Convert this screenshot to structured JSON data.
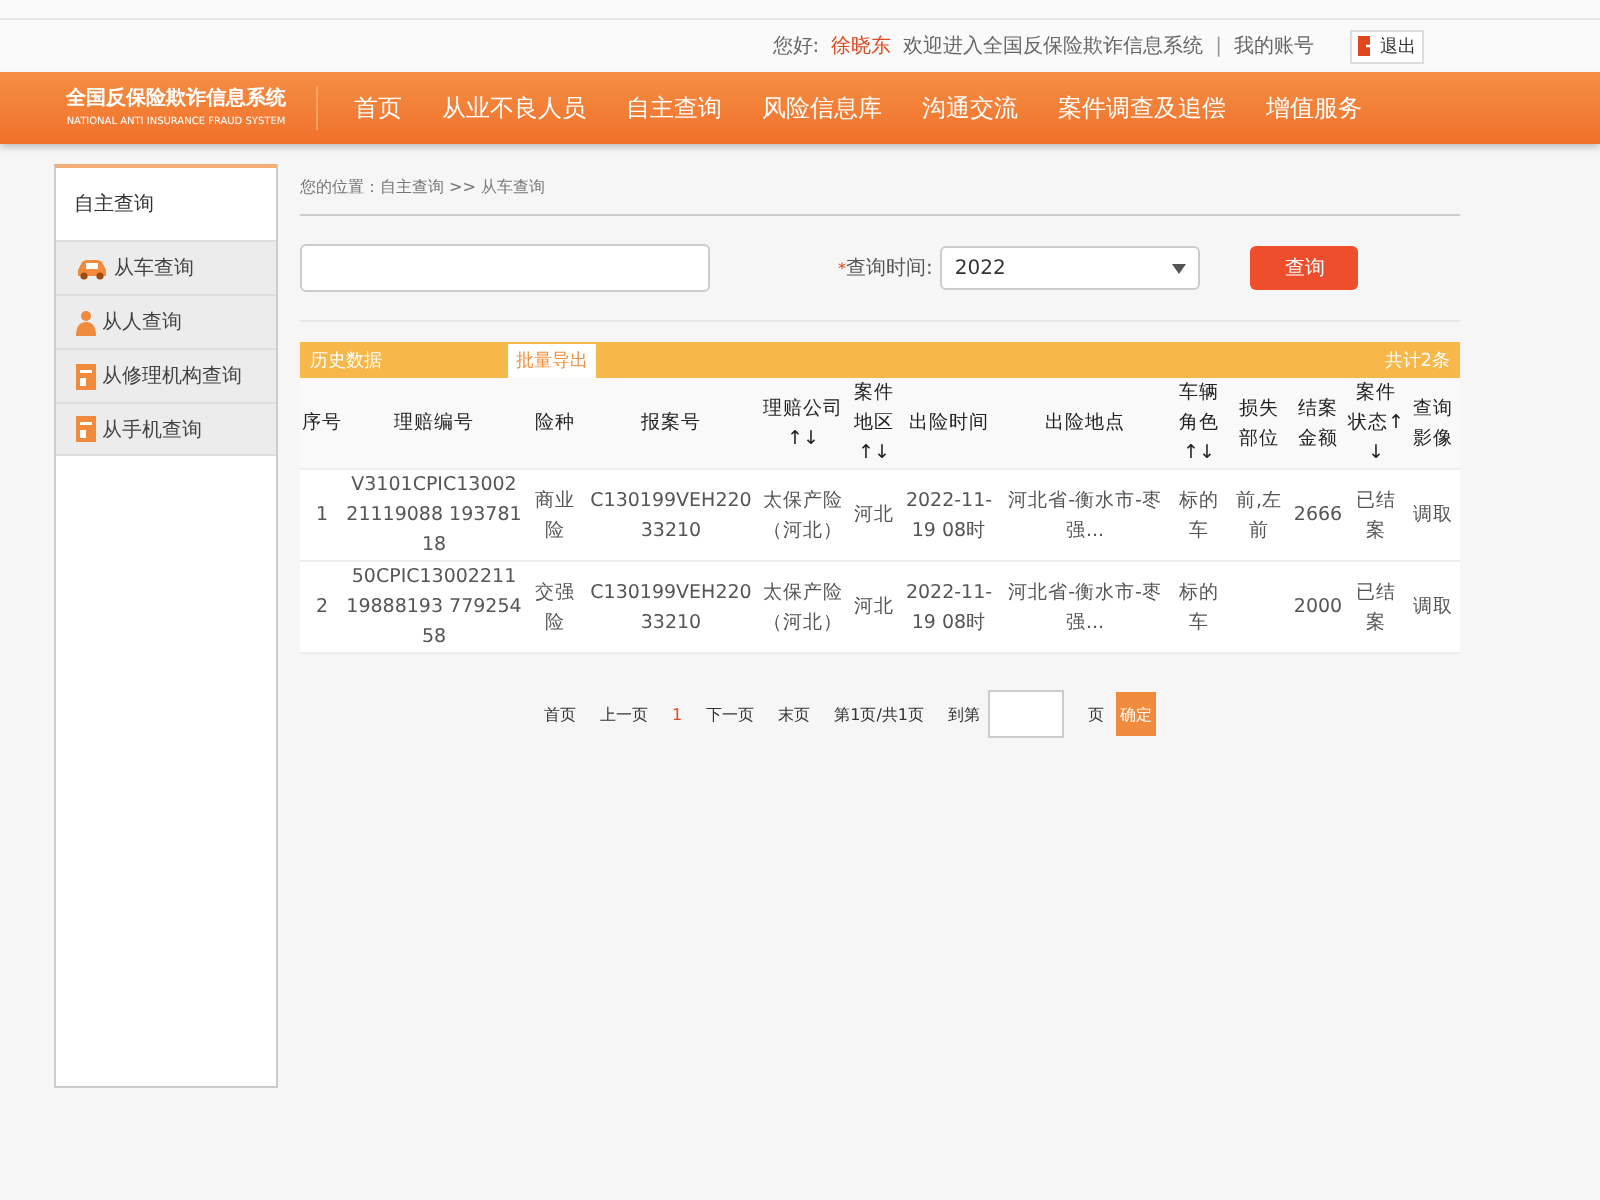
{
  "header": {
    "greeting": "您好:",
    "user": "徐晓东",
    "welcome": "欢迎进入全国反保险欺诈信息系统",
    "separator": "|",
    "account": "我的账号",
    "logout": "退出"
  },
  "logo": {
    "title": "全国反保险欺诈信息系统",
    "subtitle": "NATIONAL ANTI INSURANCE FRAUD SYSTEM"
  },
  "nav": [
    {
      "label": "首页"
    },
    {
      "label": "从业不良人员"
    },
    {
      "label": "自主查询"
    },
    {
      "label": "风险信息库"
    },
    {
      "label": "沟通交流"
    },
    {
      "label": "案件调查及追偿"
    },
    {
      "label": "增值服务"
    }
  ],
  "sidebar": {
    "title": "自主查询",
    "items": [
      {
        "label": "从车查询",
        "kind": "car"
      },
      {
        "label": "从人查询",
        "kind": "person"
      },
      {
        "label": "从修理机构查询",
        "kind": "document"
      },
      {
        "label": "从手机查询",
        "kind": "document"
      }
    ]
  },
  "breadcrumb": "您的位置：自主查询 >> 从车查询",
  "search": {
    "required_mark": "*",
    "time_label": "查询时间:",
    "year": "2022",
    "button": "查询"
  },
  "results": {
    "title": "历史数据",
    "export": "批量导出",
    "total": "共计2条",
    "columns": [
      "序号",
      "理赔编号",
      "险种",
      "报案号",
      "理赔公司↑↓",
      "案件地区↑↓",
      "出险时间",
      "出险地点",
      "车辆角色↑↓",
      "损失部位",
      "结案金额",
      "案件状态↑↓",
      "查询影像"
    ],
    "rows": [
      [
        "1",
        "V3101CPIC1300221119088 19378118",
        "商业险",
        "C130199VEH22033210",
        "太保产险（河北）",
        "河北",
        "2022-11-19 08时",
        "河北省-衡水市-枣强...",
        "标的车",
        "前,左前",
        "2666",
        "已结案",
        "调取"
      ],
      [
        "2",
        "50CPIC1300221119888193 77925458",
        "交强险",
        "C130199VEH22033210",
        "太保产险（河北）",
        "河北",
        "2022-11-19 08时",
        "河北省-衡水市-枣强...",
        "标的车",
        "",
        "2000",
        "已结案",
        "调取"
      ]
    ]
  },
  "pagination": {
    "first": "首页",
    "prev": "上一页",
    "pages": [
      {
        "label": "1",
        "selected": true
      }
    ],
    "next": "下一页",
    "last": "末页",
    "info": "第1页/共1页",
    "goto": "到第",
    "unit": "页",
    "confirm": "确定"
  }
}
